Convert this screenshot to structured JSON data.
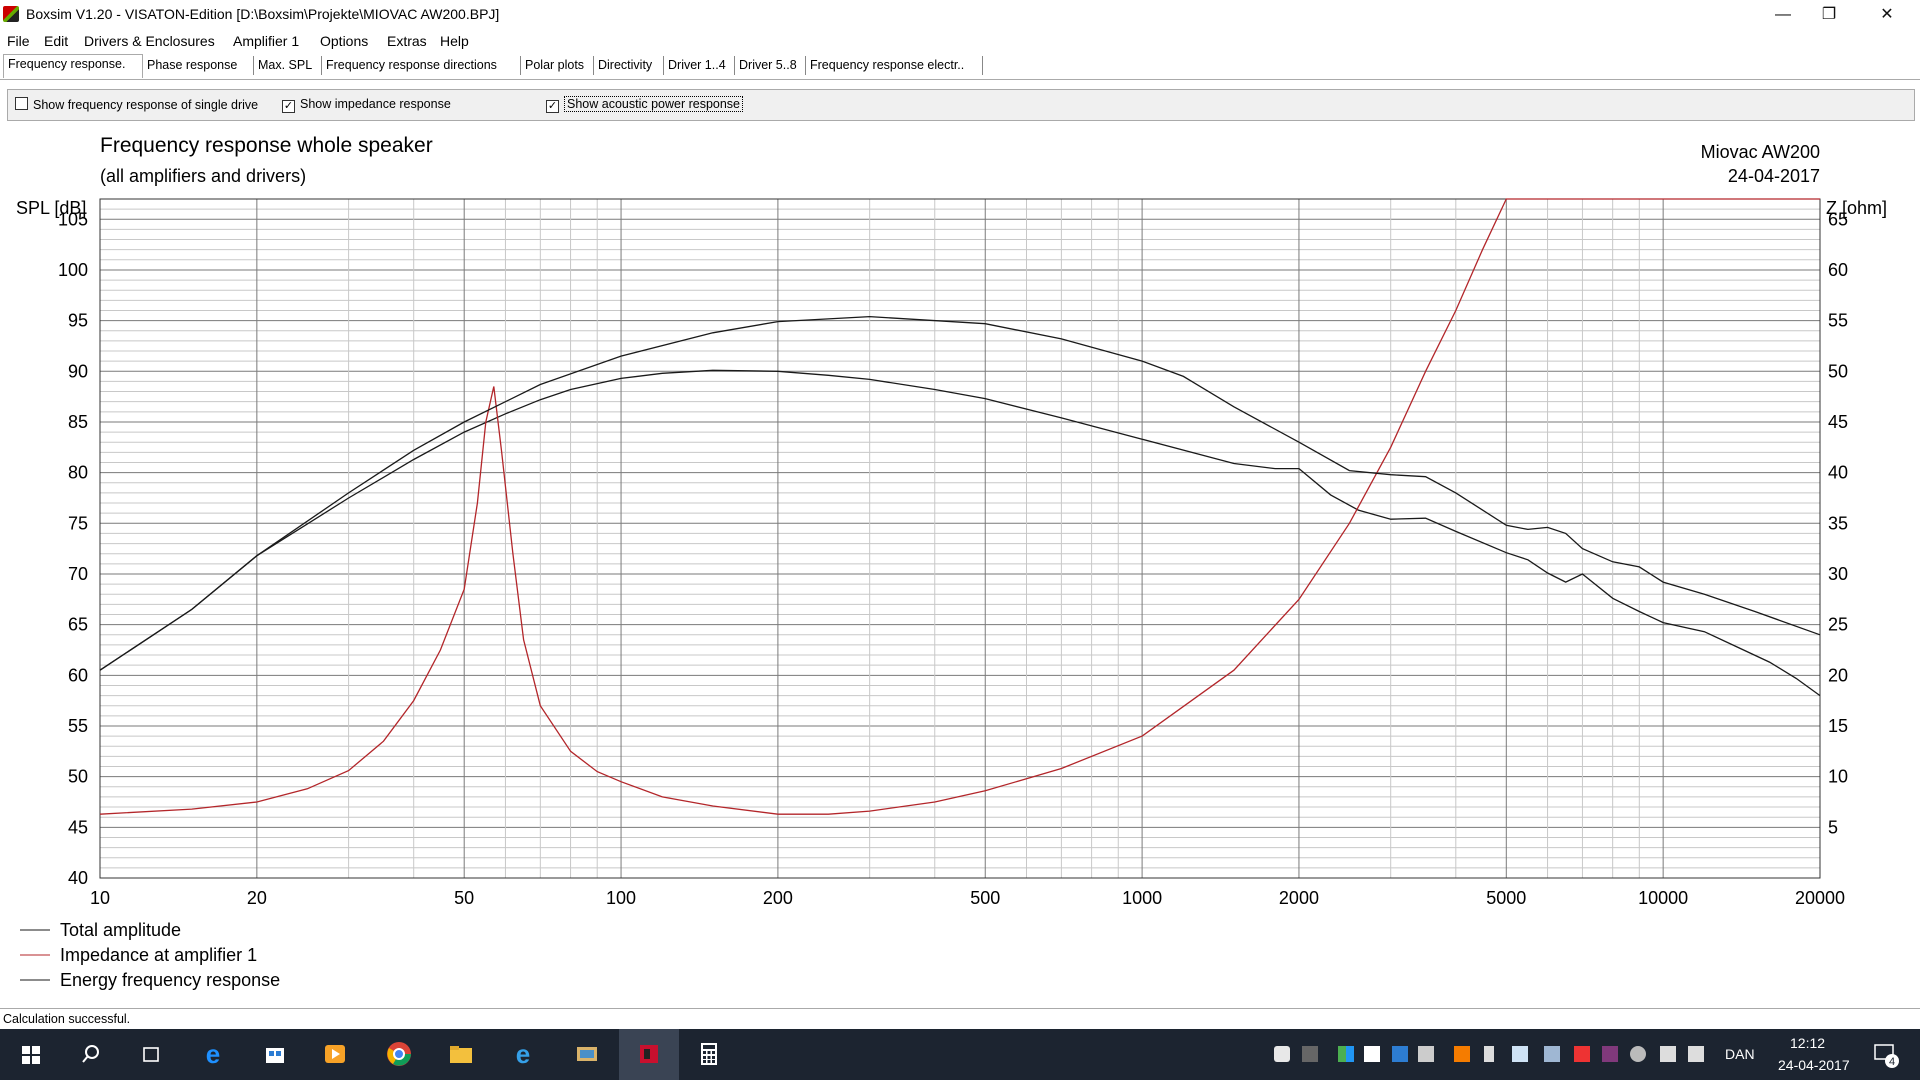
{
  "window": {
    "title": "Boxsim V1.20 - VISATON-Edition [D:\\Boxsim\\Projekte\\MIOVAC AW200.BPJ]",
    "minimize": "—",
    "restore": "❐",
    "close": "✕"
  },
  "menu": [
    "File",
    "Edit",
    "Drivers & Enclosures",
    "Amplifier 1",
    "Options",
    "Extras",
    "Help"
  ],
  "tabs": [
    "Frequency response.",
    "Phase response",
    "Max. SPL",
    "Frequency response directions",
    "Polar plots",
    "Directivity",
    "Driver 1..4",
    "Driver 5..8",
    "Frequency response electr.."
  ],
  "options": {
    "single_driver": {
      "label": "Show frequency response of single drive",
      "checked": false
    },
    "impedance": {
      "label": "Show impedance response",
      "checked": true
    },
    "acoustic_power": {
      "label": "Show acoustic power response",
      "checked": true
    }
  },
  "status": "Calculation successful.",
  "taskbar": {
    "lang": "DAN",
    "time": "12:12",
    "date": "24-04-2017",
    "notifications": "4"
  },
  "colors": {
    "impedance": "#b3262a",
    "spl": "#1a1a1a",
    "grid": "#7a7a7a",
    "grid_minor": "#c8c8c8"
  },
  "chart_data": {
    "type": "line",
    "title": "Frequency response whole speaker",
    "subtitle": "(all amplifiers and drivers)",
    "project_name": "Miovac AW200",
    "date": "24-04-2017",
    "ylabel": "SPL [dB]",
    "y2label": "Z [ohm]",
    "x_scale": "log",
    "xlim": [
      10,
      20000
    ],
    "ylim": [
      40,
      107
    ],
    "y2lim": [
      0,
      67
    ],
    "x_ticks": [
      10,
      20,
      50,
      100,
      200,
      500,
      1000,
      2000,
      5000,
      10000,
      20000
    ],
    "y_ticks": [
      40,
      45,
      50,
      55,
      60,
      65,
      70,
      75,
      80,
      85,
      90,
      95,
      100,
      105
    ],
    "y2_ticks": [
      5,
      10,
      15,
      20,
      25,
      30,
      35,
      40,
      45,
      50,
      55,
      60,
      65
    ],
    "grid": true,
    "legend_position": "bottom-left",
    "series": [
      {
        "name": "Total amplitude",
        "axis": "left",
        "color": "#1a1a1a",
        "x": [
          10,
          15,
          20,
          30,
          40,
          50,
          60,
          70,
          80,
          100,
          120,
          150,
          200,
          250,
          300,
          400,
          500,
          700,
          1000,
          1500,
          1800,
          2000,
          2300,
          2600,
          3000,
          3500,
          4000,
          5000,
          5500,
          6000,
          6500,
          7000,
          8000,
          9000,
          10000,
          12000,
          14000,
          16000,
          18000,
          20000
        ],
        "y": [
          60.5,
          66.5,
          71.8,
          77.5,
          81.3,
          84.0,
          85.8,
          87.2,
          88.2,
          89.3,
          89.8,
          90.1,
          90.0,
          89.6,
          89.2,
          88.2,
          87.3,
          85.4,
          83.3,
          80.9,
          80.4,
          80.4,
          77.8,
          76.3,
          75.4,
          75.5,
          74.2,
          72.1,
          71.4,
          70.1,
          69.2,
          70.0,
          67.6,
          66.3,
          65.2,
          64.3,
          62.7,
          61.3,
          59.7,
          58.0
        ]
      },
      {
        "name": "Impedance at amplifier 1",
        "axis": "right",
        "color": "#b3262a",
        "x": [
          10,
          15,
          20,
          25,
          30,
          35,
          40,
          45,
          50,
          53,
          55,
          57,
          59,
          62,
          65,
          70,
          80,
          90,
          100,
          120,
          150,
          200,
          250,
          300,
          400,
          500,
          700,
          1000,
          1500,
          2000,
          2500,
          3000,
          3500,
          4000,
          4500,
          5000,
          5100,
          20000
        ],
        "y": [
          6.3,
          6.8,
          7.5,
          8.8,
          10.6,
          13.5,
          17.5,
          22.5,
          28.5,
          37.0,
          45.0,
          48.5,
          42.0,
          32.0,
          23.5,
          17.0,
          12.5,
          10.5,
          9.5,
          8.0,
          7.1,
          6.3,
          6.3,
          6.6,
          7.5,
          8.6,
          10.8,
          14.0,
          20.5,
          27.5,
          35.0,
          42.5,
          50.0,
          56.0,
          62.0,
          67.0,
          67.0,
          67.0
        ]
      },
      {
        "name": "Energy frequency response",
        "axis": "left",
        "color": "#1a1a1a",
        "x": [
          10,
          15,
          20,
          30,
          40,
          50,
          70,
          100,
          150,
          200,
          300,
          500,
          700,
          1000,
          1200,
          1500,
          2000,
          2500,
          3000,
          3500,
          4000,
          5000,
          5500,
          6000,
          6500,
          7000,
          8000,
          9000,
          10000,
          12000,
          15000,
          20000
        ],
        "y": [
          60.5,
          66.5,
          71.8,
          78.0,
          82.2,
          85.0,
          88.7,
          91.5,
          93.8,
          94.9,
          95.4,
          94.7,
          93.2,
          91.0,
          89.5,
          86.5,
          83.0,
          80.2,
          79.8,
          79.6,
          78.0,
          74.8,
          74.4,
          74.6,
          74.0,
          72.5,
          71.2,
          70.7,
          69.2,
          68.0,
          66.3,
          64.0
        ]
      }
    ]
  }
}
